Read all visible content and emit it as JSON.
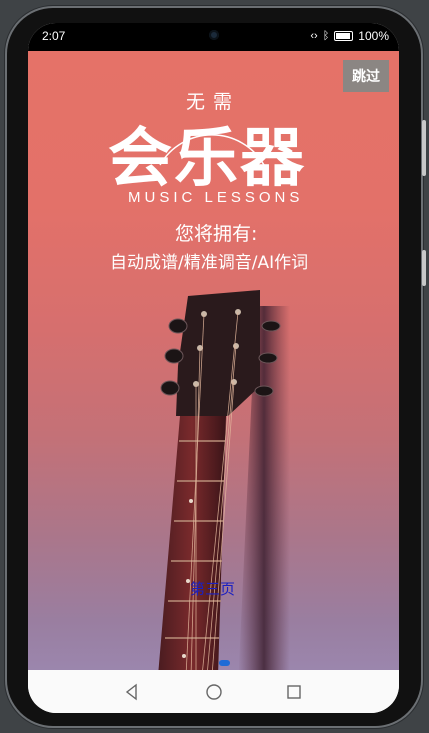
{
  "status_bar": {
    "time": "2:07",
    "battery": "100%",
    "icons": [
      "nfc-icon",
      "bluetooth-icon",
      "battery-icon"
    ]
  },
  "splash": {
    "skip_label": "跳过",
    "tagline_small": "无需",
    "title": "会乐器",
    "subtitle_en": "MUSIC LESSONS",
    "you_will_have": "您将拥有:",
    "features": "自动成谱/精准调音/AI作词",
    "page_label": "第三页",
    "background_colors": [
      "#e57268",
      "#d66f6e",
      "#9b86ad"
    ],
    "active_indicator_color": "#1e6bd6"
  },
  "nav_bar": {
    "buttons": [
      "back-icon",
      "home-icon",
      "recents-icon"
    ]
  }
}
